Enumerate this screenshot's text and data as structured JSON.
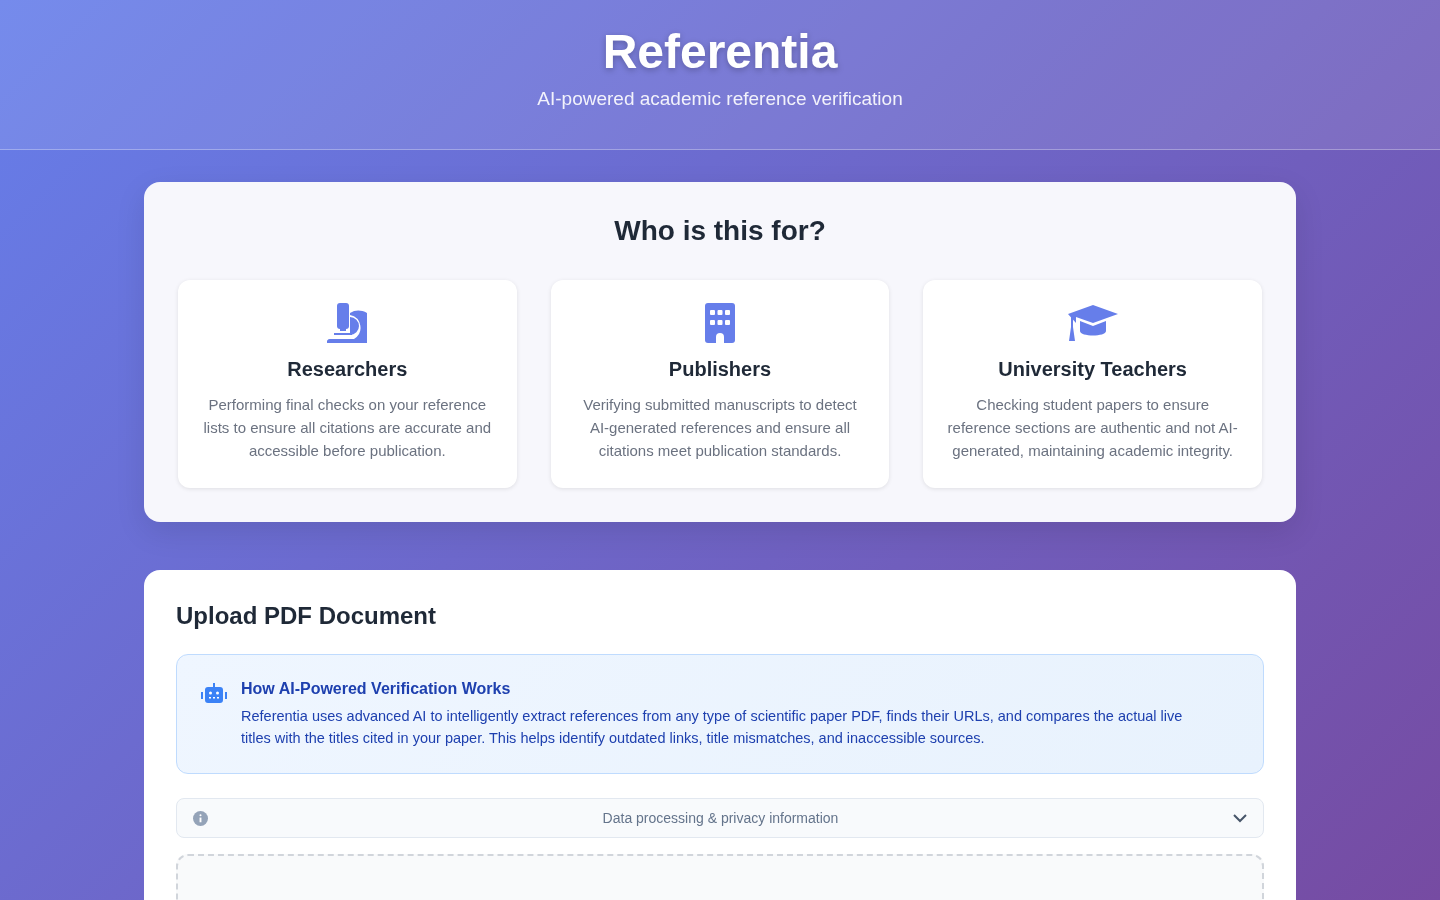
{
  "header": {
    "title": "Referentia",
    "subtitle": "AI-powered academic reference verification"
  },
  "audience": {
    "heading": "Who is this for?",
    "cards": [
      {
        "kind": "microscope",
        "title": "Researchers",
        "text": "Performing final checks on your reference lists to ensure all citations are accurate and accessible before publication."
      },
      {
        "kind": "building",
        "title": "Publishers",
        "text": "Verifying submitted manuscripts to detect AI-generated references and ensure all citations meet publication standards."
      },
      {
        "kind": "graduation",
        "title": "University Teachers",
        "text": "Checking student papers to ensure reference sections are authentic and not AI-generated, maintaining academic integrity."
      }
    ]
  },
  "upload": {
    "heading": "Upload PDF Document",
    "info": {
      "title": "How AI-Powered Verification Works",
      "text": "Referentia uses advanced AI to intelligently extract references from any type of scientific paper PDF, finds their URLs, and compares the actual live titles with the titles cited in your paper. This helps identify outdated links, title mismatches, and inaccessible sources."
    },
    "privacy": {
      "label": "Data processing & privacy information",
      "expanded": false
    }
  }
}
